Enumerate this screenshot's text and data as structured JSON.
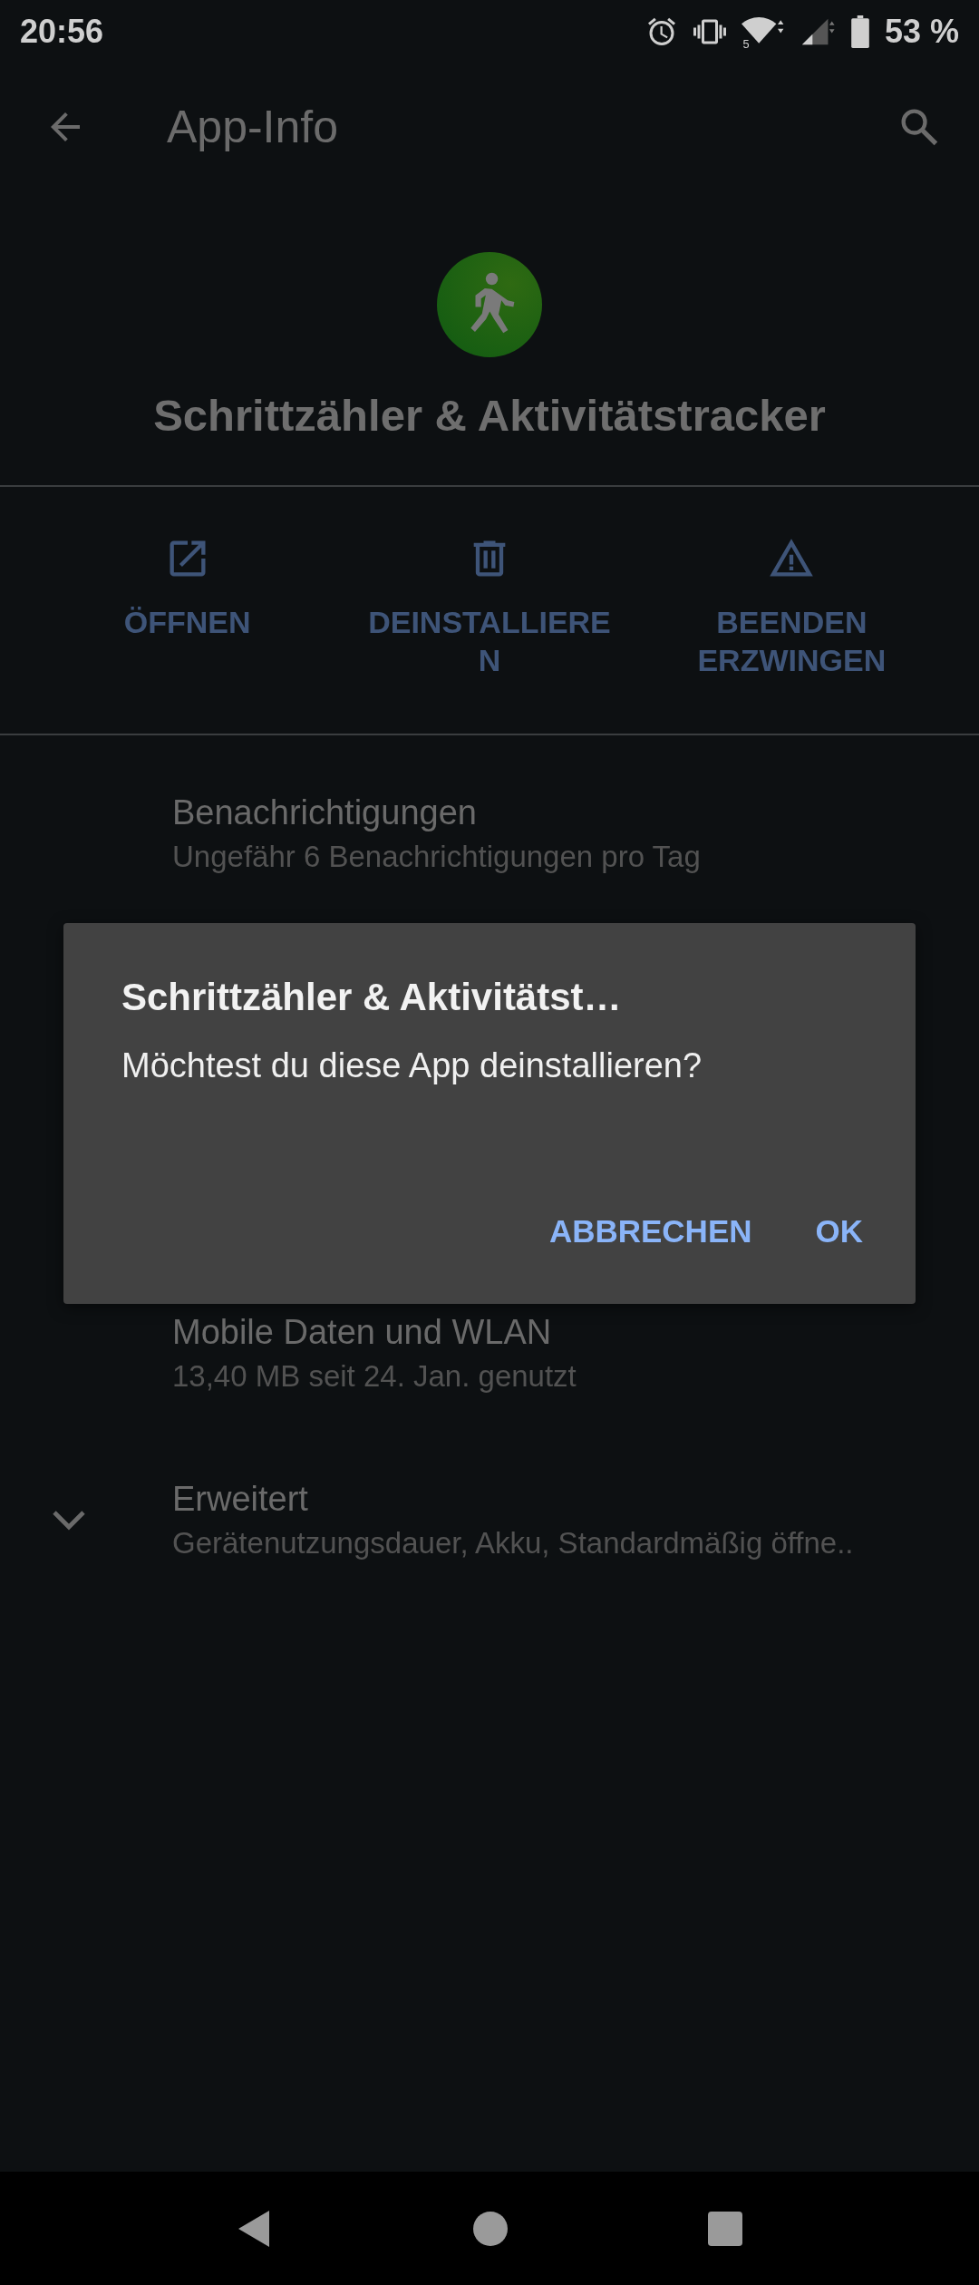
{
  "status_bar": {
    "time": "20:56",
    "battery": "53 %",
    "wifi_label": "5"
  },
  "app_bar": {
    "title": "App-Info"
  },
  "app": {
    "name": "Schrittzähler & Aktivitätstracker"
  },
  "actions": [
    {
      "kind": "open",
      "label": "ÖFFNEN"
    },
    {
      "kind": "uninstall",
      "label": "DEINSTALLIERE\nN"
    },
    {
      "kind": "force_stop",
      "label": "BEENDEN\nERZWINGEN"
    }
  ],
  "settings": [
    {
      "title": "Benachrichtigungen",
      "subtitle": "Ungefähr 6 Benachrichtigungen pro Tag",
      "expandable": false
    },
    {
      "kind": "hidden"
    },
    {
      "title": "Mobile Daten und WLAN",
      "subtitle": "13,40 MB seit 24. Jan. genutzt",
      "expandable": false
    },
    {
      "title": "Erweitert",
      "subtitle": "Gerätenutzungsdauer, Akku, Standardmäßig öffne..",
      "expandable": true
    }
  ],
  "dialog": {
    "title": "Schrittzähler & Aktivitätst…",
    "message": "Möchtest du diese App deinstallieren?",
    "buttons": [
      "ABBRECHEN",
      "OK"
    ]
  }
}
